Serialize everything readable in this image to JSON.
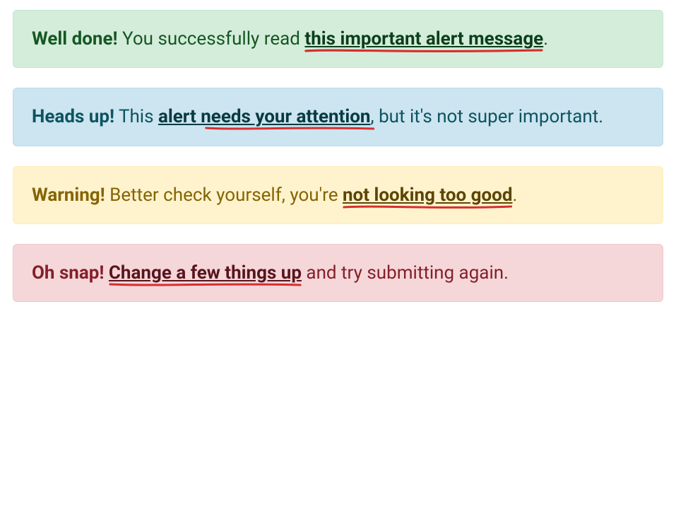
{
  "alerts": [
    {
      "variant": "success",
      "title": "Well done!",
      "before": " You successfully read ",
      "link": "this important alert message",
      "after": ".",
      "marker_on_link": true
    },
    {
      "variant": "info",
      "title": "Heads up!",
      "before": " This ",
      "link": "alert needs your attention",
      "after": ", but it's not super important.",
      "marker_on_link": true
    },
    {
      "variant": "warning",
      "title": "Warning!",
      "before": " Better check yourself, you're ",
      "link": "not looking too good",
      "after": ".",
      "marker_on_link": true
    },
    {
      "variant": "danger",
      "title": "Oh snap!",
      "before": " ",
      "link": "Change a few things up",
      "after": " and try submitting again.",
      "marker_on_link": true
    }
  ],
  "colors": {
    "marker": "#d62f2f"
  }
}
